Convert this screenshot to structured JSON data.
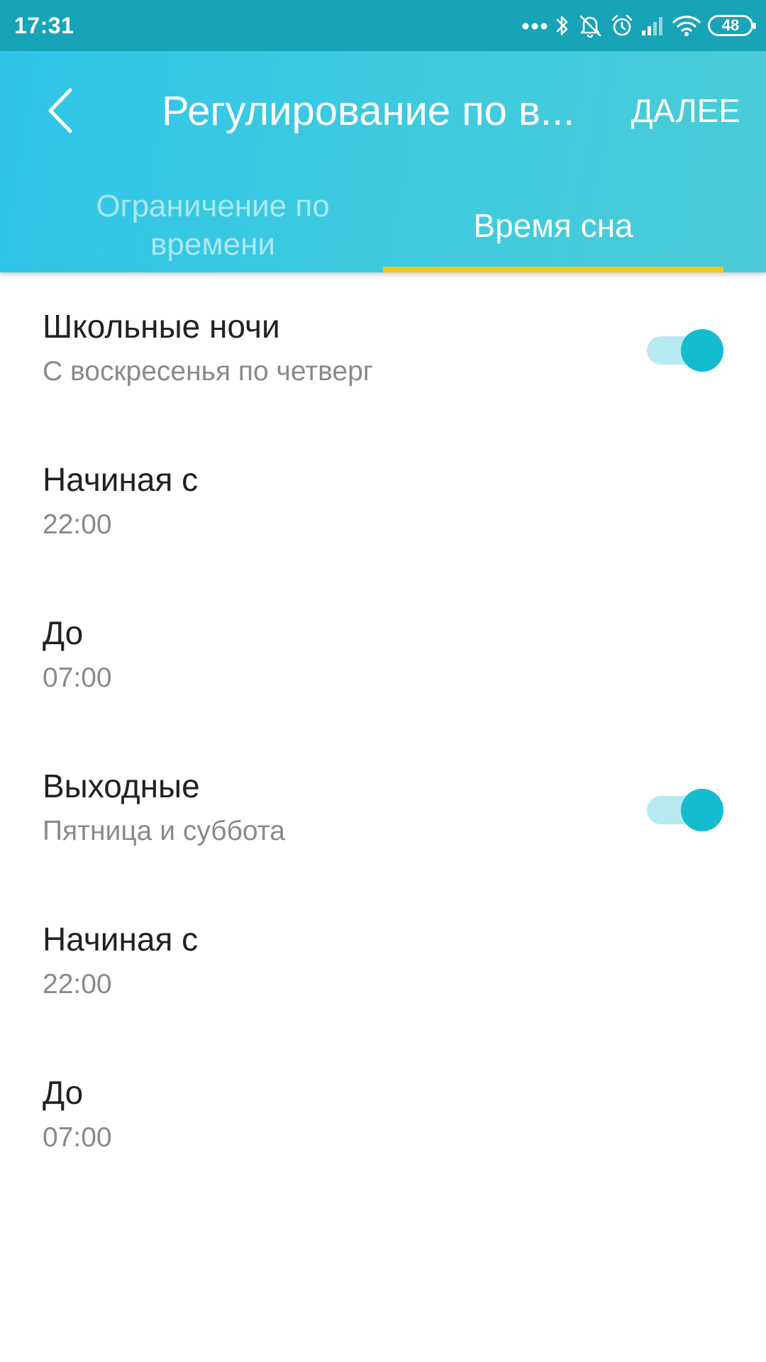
{
  "status_bar": {
    "time": "17:31",
    "battery": "48",
    "icons": [
      "more-dots-icon",
      "bluetooth-icon",
      "muted-bell-icon",
      "alarm-icon",
      "signal-icon",
      "wifi-icon",
      "battery-icon"
    ]
  },
  "header": {
    "title": "Регулирование по в...",
    "next_label": "ДАЛЕЕ",
    "back_icon": "chevron-left-icon"
  },
  "tabs": [
    {
      "label": "Ограничение по времени",
      "active": false
    },
    {
      "label": "Время сна",
      "active": true
    }
  ],
  "sections": [
    {
      "title": "Школьные ночи",
      "subtitle": "С воскресенья по четверг",
      "enabled": true,
      "start": {
        "label": "Начиная с",
        "value": "22:00"
      },
      "end": {
        "label": "До",
        "value": "07:00"
      }
    },
    {
      "title": "Выходные",
      "subtitle": "Пятница и суббота",
      "enabled": true,
      "start": {
        "label": "Начиная с",
        "value": "22:00"
      },
      "end": {
        "label": "До",
        "value": "07:00"
      }
    }
  ],
  "colors": {
    "status_bar": "#17a3b8",
    "header_gradient_start": "#2fc5e8",
    "header_gradient_end": "#4ccbd6",
    "tab_indicator": "#f2c81d",
    "toggle_thumb": "#13bccf",
    "toggle_track": "#b7eaf0"
  }
}
